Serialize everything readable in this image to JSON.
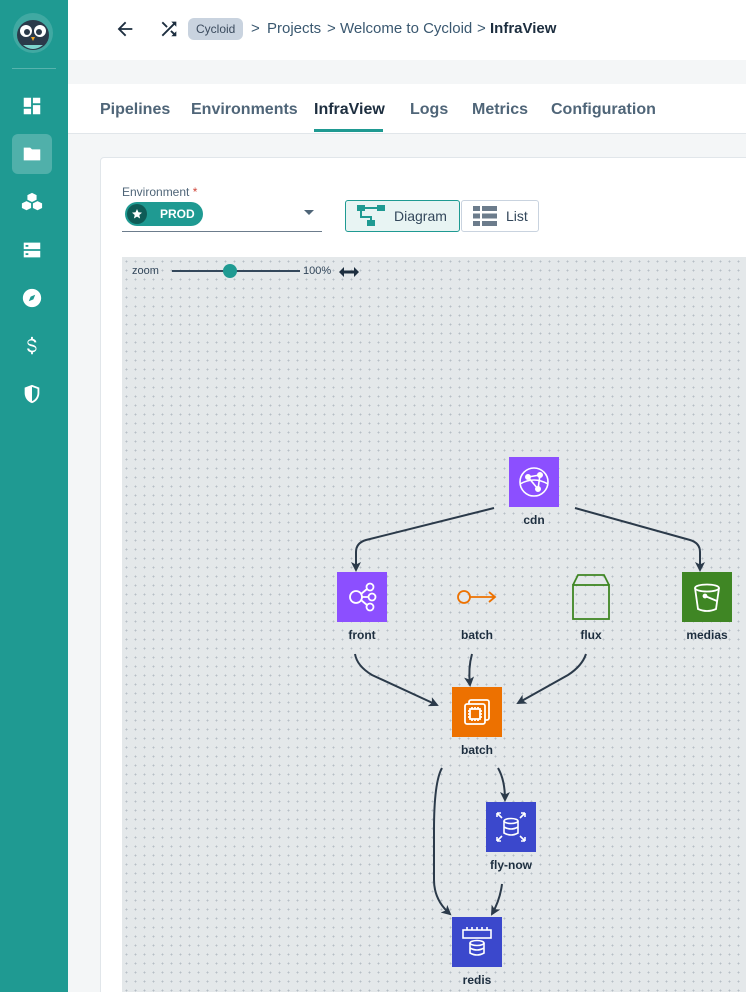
{
  "sidebar": {
    "items": [
      {
        "name": "dashboard-icon"
      },
      {
        "name": "folder-icon",
        "active": true
      },
      {
        "name": "cubes-icon"
      },
      {
        "name": "server-icon"
      },
      {
        "name": "compass-icon"
      },
      {
        "name": "dollar-icon"
      },
      {
        "name": "shield-icon"
      }
    ]
  },
  "header": {
    "organization": "Cycloid",
    "breadcrumb": [
      "Projects",
      "Welcome to Cycloid",
      "InfraView"
    ]
  },
  "tabs": [
    {
      "label": "Pipelines"
    },
    {
      "label": "Environments"
    },
    {
      "label": "InfraView",
      "active": true
    },
    {
      "label": "Logs"
    },
    {
      "label": "Metrics"
    },
    {
      "label": "Configuration"
    }
  ],
  "environment": {
    "label": "Environment",
    "required_mark": "*",
    "value": "PROD"
  },
  "view_toggle": {
    "diagram_label": "Diagram",
    "list_label": "List",
    "active": "Diagram"
  },
  "zoom": {
    "label": "zoom",
    "value": "100%",
    "level": 0.45
  },
  "diagram": {
    "nodes": [
      {
        "id": "cdn",
        "label": "cdn",
        "icon": "cloudfront-icon",
        "color": "#8c4fff"
      },
      {
        "id": "front",
        "label": "front",
        "icon": "load-balancer-icon",
        "color": "#8c4fff"
      },
      {
        "id": "batch-eip",
        "label": "batch",
        "icon": "elastic-ip-icon",
        "color": "#ed7100"
      },
      {
        "id": "flux",
        "label": "flux",
        "icon": "package-icon",
        "color": "#3f8624"
      },
      {
        "id": "medias",
        "label": "medias",
        "icon": "s3-bucket-icon",
        "color": "#3f8624"
      },
      {
        "id": "batch",
        "label": "batch",
        "icon": "ec2-instance-icon",
        "color": "#ed7100"
      },
      {
        "id": "fly-now",
        "label": "fly-now",
        "icon": "database-icon",
        "color": "#3b48cc"
      },
      {
        "id": "redis",
        "label": "redis",
        "icon": "elasticache-icon",
        "color": "#3b48cc"
      }
    ],
    "edges": [
      {
        "from": "cdn",
        "to": "front"
      },
      {
        "from": "cdn",
        "to": "medias"
      },
      {
        "from": "front",
        "to": "batch"
      },
      {
        "from": "batch-eip",
        "to": "batch"
      },
      {
        "from": "flux",
        "to": "batch"
      },
      {
        "from": "batch",
        "to": "fly-now"
      },
      {
        "from": "batch",
        "to": "redis"
      },
      {
        "from": "fly-now",
        "to": "redis"
      }
    ]
  }
}
